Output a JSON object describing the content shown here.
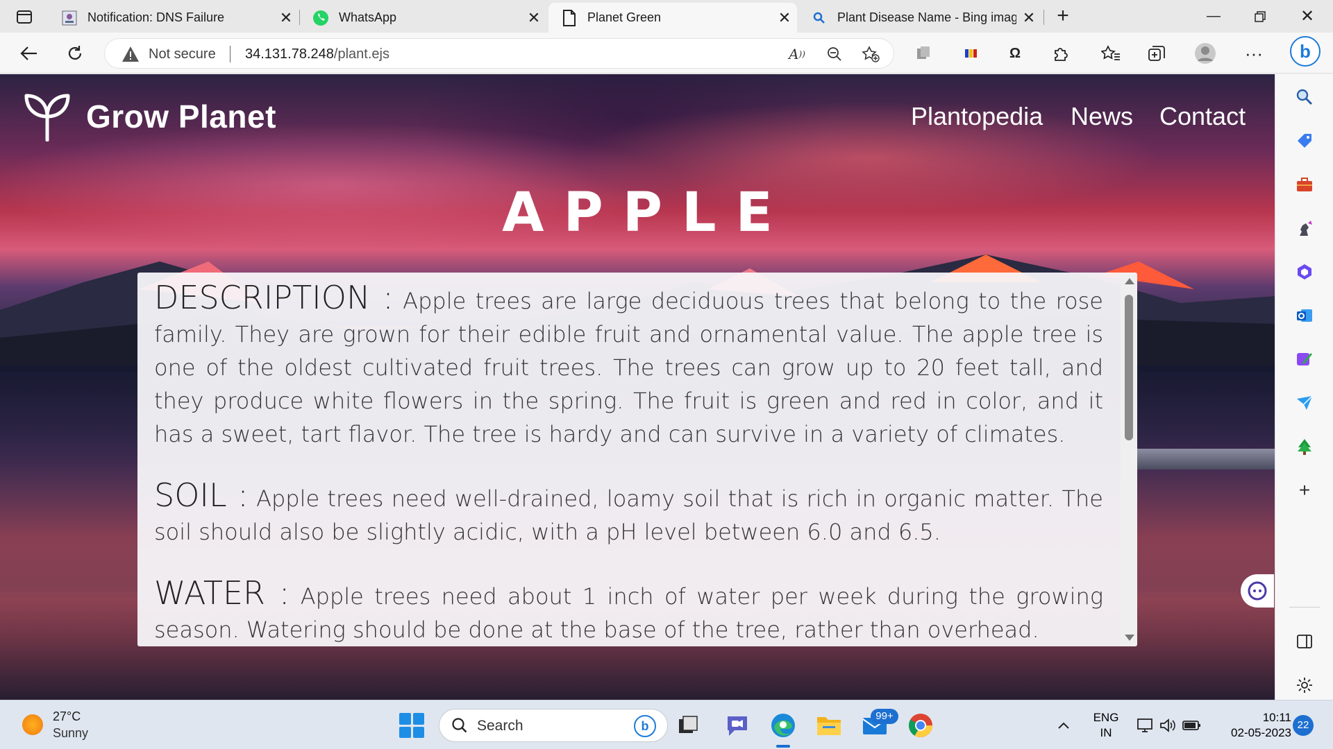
{
  "browser": {
    "tabs": [
      {
        "title": "Notification: DNS Failure",
        "favicon": "dns-icon"
      },
      {
        "title": "WhatsApp",
        "favicon": "whatsapp-icon"
      },
      {
        "title": "Planet Green",
        "favicon": "page-icon",
        "active": true
      },
      {
        "title": "Plant Disease Name - Bing images",
        "favicon": "bing-search-icon"
      }
    ],
    "security_label": "Not secure",
    "url_host": "34.131.78.248",
    "url_path": "/plant.ejs"
  },
  "site": {
    "brand": "Grow Planet",
    "nav": [
      "Plantopedia",
      "News",
      "Contact"
    ],
    "plant_name": "APPLE",
    "sections": [
      {
        "label": "DESCRIPTION :",
        "text": "Apple trees are large deciduous trees that belong to the rose family. They are grown for their edible fruit and ornamental value. The apple tree is one of the oldest cultivated fruit trees. The trees can grow up to 20 feet tall, and they produce white flowers in the spring. The fruit is green and red in color, and it has a sweet, tart flavor. The tree is hardy and can survive in a variety of climates."
      },
      {
        "label": "SOIL :",
        "text": "Apple trees need well-drained, loamy soil that is rich in organic matter. The soil should also be slightly acidic, with a pH level between 6.0 and 6.5."
      },
      {
        "label": "WATER :",
        "text": "Apple trees need about 1 inch of water per week during the growing season. Watering should be done at the base of the tree, rather than overhead."
      }
    ]
  },
  "taskbar": {
    "weather_temp": "27°C",
    "weather_cond": "Sunny",
    "search_label": "Search",
    "mail_badge": "99+",
    "lang_1": "ENG",
    "lang_2": "IN",
    "time": "10:11",
    "date": "02-05-2023",
    "notifications": "22"
  },
  "colors": {
    "accent": "#1d6fd0",
    "card_bg": "#f8f6fa",
    "text": "#2a2a2a"
  }
}
